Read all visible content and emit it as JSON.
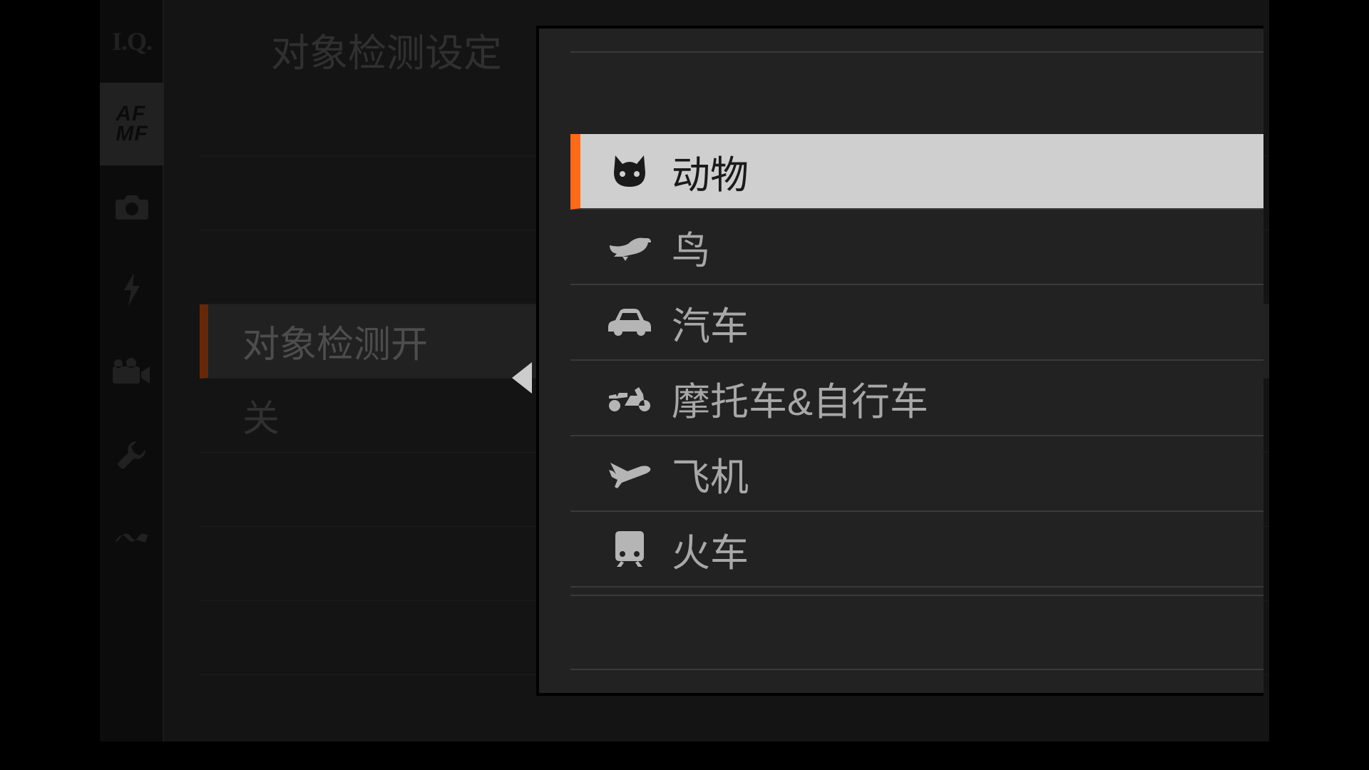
{
  "sidebar": {
    "items": [
      {
        "id": "iq",
        "label": "I.Q."
      },
      {
        "id": "afmf",
        "label_top": "AF",
        "label_bottom": "MF"
      },
      {
        "id": "camera"
      },
      {
        "id": "flash"
      },
      {
        "id": "movie"
      },
      {
        "id": "wrench"
      },
      {
        "id": "wave"
      }
    ],
    "selected_index": 1
  },
  "page": {
    "title": "对象检测设定"
  },
  "left_menu": {
    "rows": [
      {
        "label": ""
      },
      {
        "label": ""
      },
      {
        "label": ""
      },
      {
        "label": "对象检测开",
        "selected": true
      },
      {
        "label": "关"
      },
      {
        "label": ""
      },
      {
        "label": ""
      },
      {
        "label": ""
      }
    ]
  },
  "popup": {
    "options": [
      {
        "icon": "cat",
        "label": "动物",
        "selected": true
      },
      {
        "icon": "bird",
        "label": "鸟"
      },
      {
        "icon": "car",
        "label": "汽车"
      },
      {
        "icon": "motorcycle",
        "label": "摩托车&自行车"
      },
      {
        "icon": "airplane",
        "label": "飞机"
      },
      {
        "icon": "train",
        "label": "火车"
      }
    ]
  }
}
